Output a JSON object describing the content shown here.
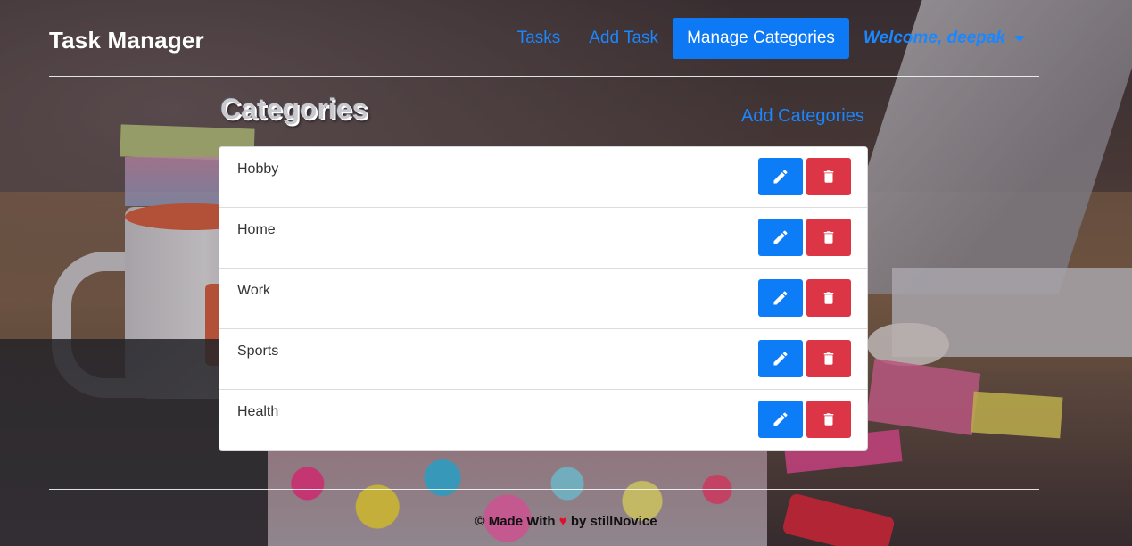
{
  "brand": "Task Manager",
  "nav": {
    "tasks": "Tasks",
    "add_task": "Add Task",
    "manage_categories": "Manage Categories",
    "welcome": "Welcome, deepak"
  },
  "page": {
    "heading": "Categories",
    "add_link": "Add Categories"
  },
  "categories": [
    {
      "name": "Hobby"
    },
    {
      "name": "Home"
    },
    {
      "name": "Work"
    },
    {
      "name": "Sports"
    },
    {
      "name": "Health"
    }
  ],
  "icons": {
    "edit": "pencil-icon",
    "delete": "trash-icon",
    "dropdown": "caret-down-icon",
    "heart": "heart-icon"
  },
  "footer": {
    "copyright": "©",
    "made_with": "Made With",
    "heart": "♥",
    "by": "by stillNovice"
  },
  "colors": {
    "primary": "#0d7df7",
    "danger": "#dc3545",
    "link": "#1a86ff"
  }
}
